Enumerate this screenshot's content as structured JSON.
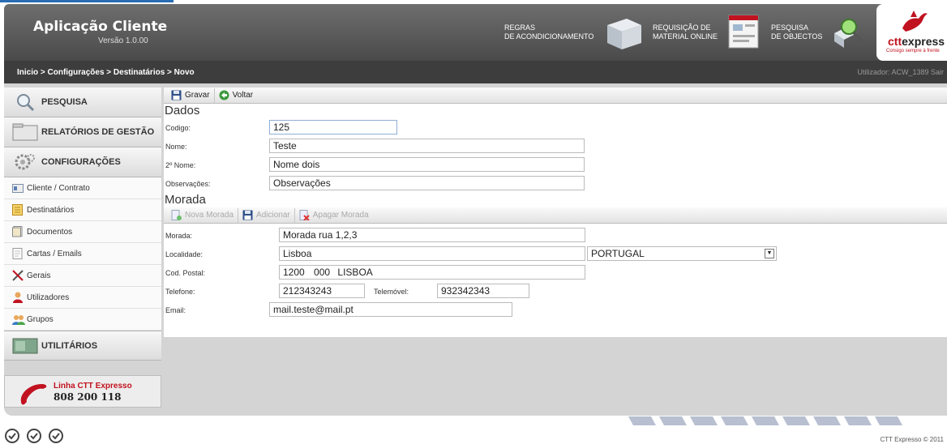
{
  "header": {
    "app_title": "Aplicação Cliente",
    "version": "Versão 1.0.00",
    "links": [
      {
        "line1": "REGRAS",
        "line2": "DE ACONDICIONAMENTO",
        "icon": "box-icon"
      },
      {
        "line1": "REQUISIÇÃO DE",
        "line2": "MATERIAL ONLINE",
        "icon": "form-icon"
      },
      {
        "line1": "PESQUISA",
        "line2": "DE OBJECTOS",
        "icon": "magnifier-package-icon"
      }
    ],
    "logo": {
      "text_red": "ctt",
      "text_dark": "express",
      "tagline": "Consigo sempre à frente"
    }
  },
  "breadcrumb": "Inicio > Configurações > Destinatários > Novo",
  "user_info": "Utilizador: ACW_1389   Sair",
  "sidebar": {
    "sections": [
      {
        "label": "PESQUISA",
        "icon": "search-icon"
      },
      {
        "label": "RELATÓRIOS DE GESTÃO",
        "icon": "folder-icon"
      },
      {
        "label": "CONFIGURAÇÕES",
        "icon": "gears-icon"
      }
    ],
    "items": [
      {
        "label": "Cliente / Contrato",
        "icon": "id-card-icon"
      },
      {
        "label": "Destinatários",
        "icon": "address-book-icon"
      },
      {
        "label": "Documentos",
        "icon": "document-icon"
      },
      {
        "label": "Cartas / Emails",
        "icon": "letter-icon"
      },
      {
        "label": "Gerais",
        "icon": "tools-icon"
      },
      {
        "label": "Utilizadores",
        "icon": "user-icon"
      },
      {
        "label": "Grupos",
        "icon": "group-icon"
      }
    ],
    "utilities": {
      "label": "UTILITÁRIOS",
      "icon": "utilities-icon"
    },
    "hotline": {
      "line1": "Linha CTT Expresso",
      "line2": "808 200 118",
      "icon": "phone-icon"
    }
  },
  "toolbar": {
    "save_label": "Gravar",
    "back_label": "Voltar"
  },
  "dados": {
    "title": "Dados",
    "codigo_label": "Codigo:",
    "codigo_value": "125",
    "nome_label": "Nome:",
    "nome_value": "Teste",
    "nome2_label": "2º Nome:",
    "nome2_value": "Nome dois",
    "obs_label": "Observações:",
    "obs_value": "Observações"
  },
  "morada": {
    "title": "Morada",
    "toolbar": {
      "new_label": "Nova Morada",
      "add_label": "Adicionar",
      "delete_label": "Apagar Morada"
    },
    "morada_label": "Morada:",
    "morada_value": "Morada rua 1,2,3",
    "localidade_label": "Localidade:",
    "localidade_value": "Lisboa",
    "country_value": "PORTUGAL",
    "cp_label": "Cod. Postal:",
    "cp4": "1200",
    "cp3": "000",
    "cp_city": "LISBOA",
    "telefone_label": "Telefone:",
    "telefone_value": "212343243",
    "telemovel_label": "Telemóvel:",
    "telemovel_value": "932342343",
    "email_label": "Email:",
    "email_value": "mail.teste@mail.pt"
  },
  "footer": {
    "copyright": "CTT Expresso © 2011"
  },
  "colors": {
    "header_bg": "#5a5a5a",
    "crumb_bg": "#3d3d3d",
    "frame_bg": "#d4d4d4",
    "brand_red": "#c1121f"
  }
}
